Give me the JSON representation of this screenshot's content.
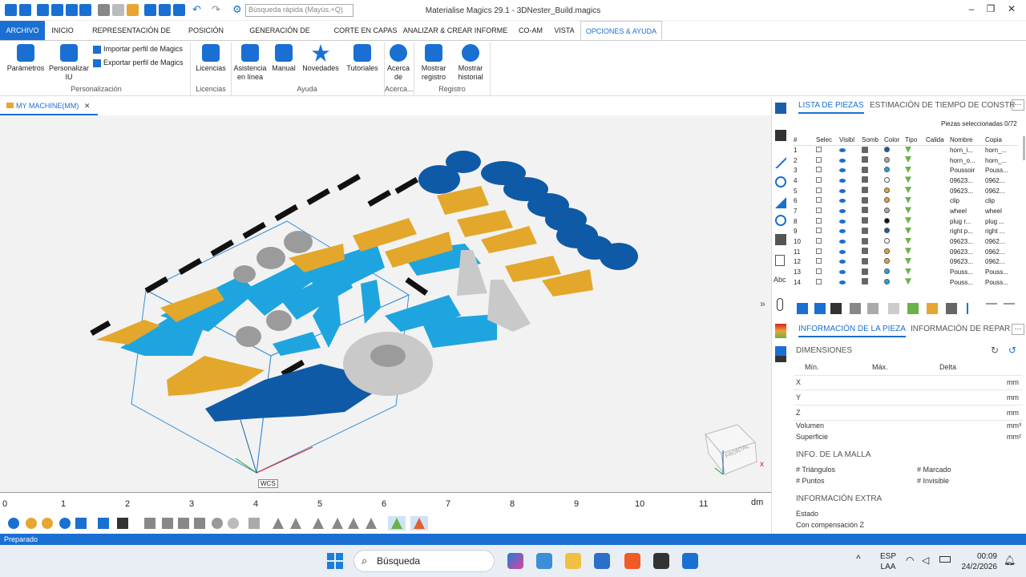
{
  "window": {
    "title": "Materialise Magics 29.1 - 3DNester_Build.magics",
    "search_placeholder": "Búsqueda rápida (Mayús.+Q)"
  },
  "menu_tabs": [
    "ARCHIVO",
    "INICIO",
    "REPRESENTACIÓN DE PIEZAS",
    "POSICIÓN",
    "GENERACIÓN DE SOPORTES",
    "CORTE EN CAPAS",
    "ANALIZAR & CREAR INFORME",
    "CO-AM",
    "VISTA",
    "OPCIONES & AYUDA"
  ],
  "ribbon": {
    "parametros": "Parámetros",
    "personalizar": "Personalizar IU",
    "importar": "Importar perfil de Magics",
    "exportar": "Exportar perfil de Magics",
    "grp_personalizacion": "Personalización",
    "licencias": "Licencias",
    "grp_licencias": "Licencias",
    "asistencia": "Asistencia en línea",
    "manual": "Manual",
    "novedades": "Novedades",
    "tutoriales": "Tutoriales",
    "grp_ayuda": "Ayuda",
    "acerca": "Acerca de",
    "grp_acerca": "Acerca...",
    "mostrar_registro": "Mostrar registro",
    "mostrar_historial": "Mostrar historial",
    "grp_registro": "Registro"
  },
  "doc_tab": "MY MACHINE(MM)",
  "viewport": {
    "wcs": "WCS",
    "cube_label": "FRONTAL",
    "ruler_ticks": [
      "0",
      "1",
      "2",
      "3",
      "4",
      "5",
      "6",
      "7",
      "8",
      "9",
      "10",
      "11"
    ],
    "ruler_unit": "dm"
  },
  "parts_panel": {
    "tab1": "LISTA DE PIEZAS",
    "tab2": "ESTIMACIÓN DE TIEMPO DE CONSTR",
    "selected_label": "Piezas seleccionadas",
    "selected_value": "0/72",
    "columns": [
      "#",
      "Selec",
      "Visibl",
      "Somb",
      "Color",
      "Tipo",
      "Calida",
      "Nombre",
      "Copia"
    ],
    "rows": [
      {
        "n": "1",
        "color": "#1a5ea8",
        "name": "horn_i...",
        "copy": "horn_..."
      },
      {
        "n": "2",
        "color": "#aaaaaa",
        "name": "horn_o...",
        "copy": "horn_..."
      },
      {
        "n": "3",
        "color": "#1ea5e0",
        "name": "Poussoir",
        "copy": "Pouss..."
      },
      {
        "n": "4",
        "color": "#ffffff",
        "name": "09623...",
        "copy": "0962..."
      },
      {
        "n": "5",
        "color": "#e8a532",
        "name": "09623...",
        "copy": "0962..."
      },
      {
        "n": "6",
        "color": "#e8a532",
        "name": "clip",
        "copy": "clip"
      },
      {
        "n": "7",
        "color": "#aaaaaa",
        "name": "wheel",
        "copy": "wheel"
      },
      {
        "n": "8",
        "color": "#111111",
        "name": "plug r...",
        "copy": "plug ..."
      },
      {
        "n": "9",
        "color": "#1a5ea8",
        "name": "right p...",
        "copy": "right ..."
      },
      {
        "n": "10",
        "color": "#ffffff",
        "name": "09623...",
        "copy": "0962..."
      },
      {
        "n": "11",
        "color": "#e8a532",
        "name": "09623...",
        "copy": "0962..."
      },
      {
        "n": "12",
        "color": "#e8a532",
        "name": "09623...",
        "copy": "0962..."
      },
      {
        "n": "13",
        "color": "#1ea5e0",
        "name": "Pouss...",
        "copy": "Pouss..."
      },
      {
        "n": "14",
        "color": "#1ea5e0",
        "name": "Pouss...",
        "copy": "Pouss..."
      }
    ]
  },
  "info_panel": {
    "tab1": "INFORMACIÓN DE LA PIEZA",
    "tab2": "INFORMACIÓN DE REPAR",
    "dimensiones": "DIMENSIONES",
    "min": "Mín.",
    "max": "Máx.",
    "delta": "Delta",
    "x": "X",
    "y": "Y",
    "z": "Z",
    "unit_mm": "mm",
    "volumen": "Volumen",
    "unit_mm3": "mm³",
    "superficie": "Superficie",
    "unit_mm2": "mm²",
    "malla": "INFO. DE LA MALLA",
    "triangulos": "# Triángulos",
    "marcado": "# Marcado",
    "puntos": "# Puntos",
    "invisible": "# Invisible",
    "extra": "INFORMACIÓN EXTRA",
    "estado": "Estado",
    "compensacion": "Con compensación Z"
  },
  "status": "Preparado",
  "taskbar": {
    "search": "Búsqueda",
    "lang1": "ESP",
    "lang2": "LAA",
    "time": "00:09",
    "date": "24/2/2026"
  }
}
